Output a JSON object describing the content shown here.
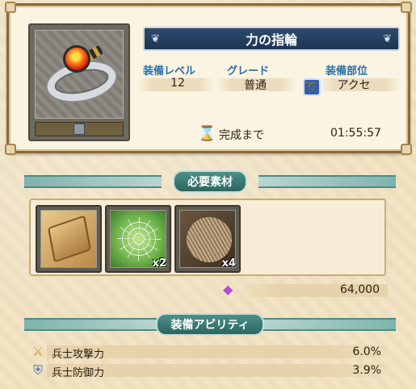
{
  "item": {
    "name": "力の指輪",
    "stats": {
      "level_label": "装備レベル",
      "level_value": "12",
      "grade_label": "グレード",
      "grade_value": "普通",
      "slot_label": "装備部位",
      "slot_value": "アクセ"
    },
    "timer": {
      "label": "完成まで",
      "value": "01:55:57"
    }
  },
  "materials": {
    "header": "必要素材",
    "items": [
      {
        "icon": "scroll-icon",
        "count": ""
      },
      {
        "icon": "spider-web-icon",
        "count": "x2"
      },
      {
        "icon": "fur-icon",
        "count": "x4"
      }
    ],
    "cost_icon": "crystal-icon",
    "cost": "64,000"
  },
  "abilities": {
    "header": "装備アビリティ",
    "rows": [
      {
        "icon": "sword-icon",
        "name": "兵士攻撃力",
        "value": "6.0%"
      },
      {
        "icon": "shield-icon",
        "name": "兵士防御力",
        "value": "3.9%"
      }
    ]
  },
  "colors": {
    "title_bar": "#1d3452",
    "stat_label": "#2b6fa8",
    "section_pill": "#2c6660",
    "panel_border": "#8a6a3a"
  }
}
